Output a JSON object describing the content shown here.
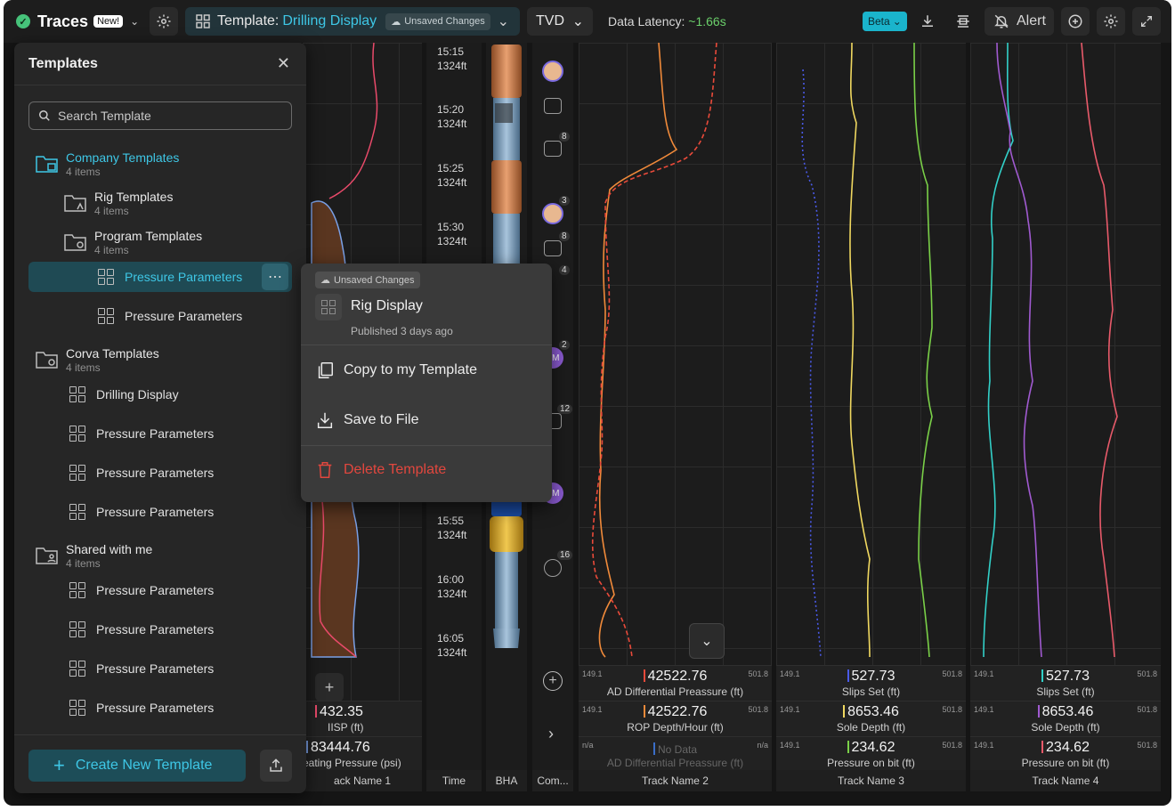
{
  "topbar": {
    "app_name": "Traces",
    "new_badge": "New!",
    "template_label": "Template:",
    "template_value": "Drilling Display",
    "unsaved": "Unsaved Changes",
    "depth_mode": "TVD",
    "latency_label": "Data Latency:",
    "latency_value": "~1.66s",
    "beta": "Beta",
    "alert": "Alert"
  },
  "sidebar": {
    "title": "Templates",
    "search_placeholder": "Search Template",
    "groups": [
      {
        "name": "Company Templates",
        "count": "4 items"
      },
      {
        "name": "Rig Templates",
        "count": "4 items"
      },
      {
        "name": "Program Templates",
        "count": "4 items"
      },
      {
        "name": "Corva Templates",
        "count": "4 items"
      },
      {
        "name": "Shared with me",
        "count": "4 items"
      }
    ],
    "templates": [
      "Pressure Parameters",
      "Pressure Parameters",
      "Drilling Display",
      "Pressure Parameters",
      "Pressure Parameters",
      "Pressure Parameters",
      "Pressure Parameters",
      "Pressure Parameters",
      "Pressure Parameters",
      "Pressure Parameters"
    ],
    "create_label": "Create New Template"
  },
  "context_menu": {
    "chip": "Unsaved Changes",
    "title": "Rig Display",
    "subtitle": "Published 3 days ago",
    "copy": "Copy to my Template",
    "save": "Save to File",
    "delete": "Delete Template"
  },
  "time_axis": [
    {
      "time": "15:15",
      "depth": "1324ft"
    },
    {
      "time": "15:20",
      "depth": "1324ft"
    },
    {
      "time": "15:25",
      "depth": "1324ft"
    },
    {
      "time": "15:30",
      "depth": "1324ft"
    },
    {
      "time": "15:55",
      "depth": "1324ft"
    },
    {
      "time": "16:00",
      "depth": "1324ft"
    },
    {
      "time": "16:05",
      "depth": "1324ft"
    }
  ],
  "columns": {
    "track1": "ack Name 1",
    "time": "Time",
    "bha": "BHA",
    "com": "Com...",
    "track2": "Track Name 2",
    "track3": "Track Name 3",
    "track4": "Track Name 4"
  },
  "comment_badges": [
    "8",
    "3",
    "8",
    "4",
    "2",
    "12",
    "16"
  ],
  "comment_initials": [
    "EM",
    "EM"
  ],
  "track1_readouts": [
    {
      "value": "432.35",
      "name": "IISP (ft)",
      "color": "#e94a6a"
    },
    {
      "value": "83444.76",
      "name": "eating Pressure (psi)",
      "color": "#7aa0e6"
    }
  ],
  "track2_readouts": [
    {
      "min": "149.1",
      "max": "501.8",
      "value": "42522.76",
      "name": "AD Differential Preassure (ft)",
      "color": "#e94a3a"
    },
    {
      "min": "149.1",
      "max": "501.8",
      "value": "42522.76",
      "name": "ROP Depth/Hour (ft)",
      "color": "#f08a3a"
    },
    {
      "min": "n/a",
      "max": "n/a",
      "value": "No Data",
      "name": "AD Differential Preassure (ft)",
      "color": "#3a6ec8"
    }
  ],
  "track3_readouts": [
    {
      "min": "149.1",
      "max": "501.8",
      "value": "527.73",
      "name": "Slips Set (ft)",
      "color": "#4a5ae8"
    },
    {
      "min": "149.1",
      "max": "501.8",
      "value": "8653.46",
      "name": "Sole Depth (ft)",
      "color": "#f0d860"
    },
    {
      "min": "149.1",
      "max": "501.8",
      "value": "234.62",
      "name": "Pressure on bit (ft)",
      "color": "#7ad048"
    }
  ],
  "track4_readouts": [
    {
      "min": "149.1",
      "max": "501.8",
      "value": "527.73",
      "name": "Slips Set (ft)",
      "color": "#32d0c8"
    },
    {
      "min": "149.1",
      "max": "501.8",
      "value": "8653.46",
      "name": "Sole Depth (ft)",
      "color": "#a05ad0"
    },
    {
      "min": "149.1",
      "max": "501.8",
      "value": "234.62",
      "name": "Pressure on bit (ft)",
      "color": "#e85a6a"
    }
  ]
}
